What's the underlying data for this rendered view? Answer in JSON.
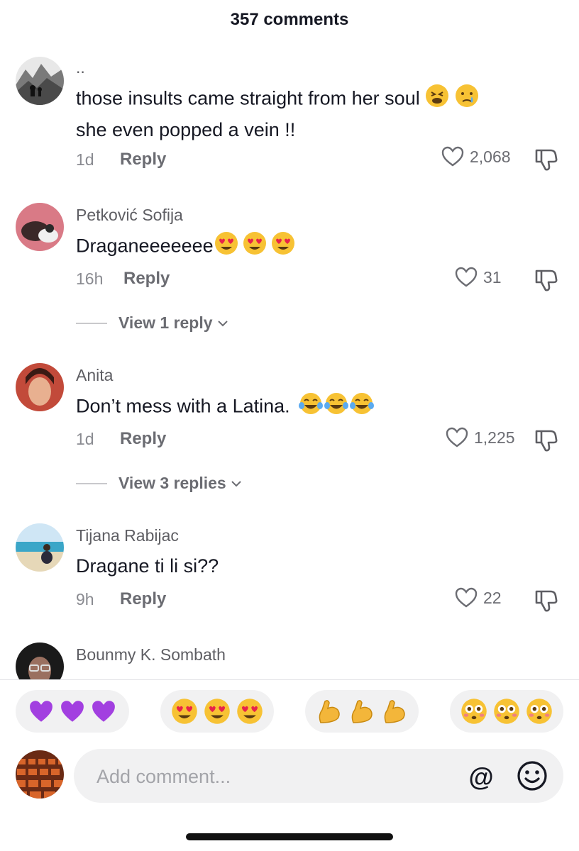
{
  "header": {
    "title": "357 comments"
  },
  "comments": [
    {
      "username": "..",
      "text_line1": "those insults came straight from her soul",
      "text_line2": "she even popped a vein !!",
      "time": "1d",
      "reply_label": "Reply",
      "likes": "2,068",
      "avatar": "mountain-landscape-avatar"
    },
    {
      "username": "Petković Sofija",
      "text": "Draganeeeeeee",
      "time": "16h",
      "reply_label": "Reply",
      "likes": "31",
      "view_replies": "View 1 reply",
      "avatar": "person-with-cat-avatar"
    },
    {
      "username": "Anita",
      "text": "Don’t mess with a Latina.",
      "time": "1d",
      "reply_label": "Reply",
      "likes": "1,225",
      "view_replies": "View 3 replies",
      "avatar": "smiling-woman-avatar"
    },
    {
      "username": "Tijana Rabijac",
      "text": "Dragane ti li si??",
      "time": "9h",
      "reply_label": "Reply",
      "likes": "22",
      "avatar": "beach-avatar"
    },
    {
      "username": "Bounmy K. Sombath",
      "avatar": "woman-with-glasses-avatar"
    }
  ],
  "quick_reactions": [
    {
      "name": "purple-hearts",
      "emojis": [
        "💜",
        "💜",
        "💜"
      ]
    },
    {
      "name": "heart-eyes",
      "emojis": [
        "😍",
        "😍",
        "😍"
      ]
    },
    {
      "name": "flexed-biceps",
      "emojis": [
        "💪",
        "💪",
        "💪"
      ]
    },
    {
      "name": "flushed-faces",
      "emojis": [
        "😳",
        "😳",
        "😳"
      ]
    }
  ],
  "composer": {
    "placeholder": "Add comment..."
  },
  "colors": {
    "text": "#161823",
    "muted": "#8a8b91",
    "pill_bg": "#f1f1f2"
  }
}
